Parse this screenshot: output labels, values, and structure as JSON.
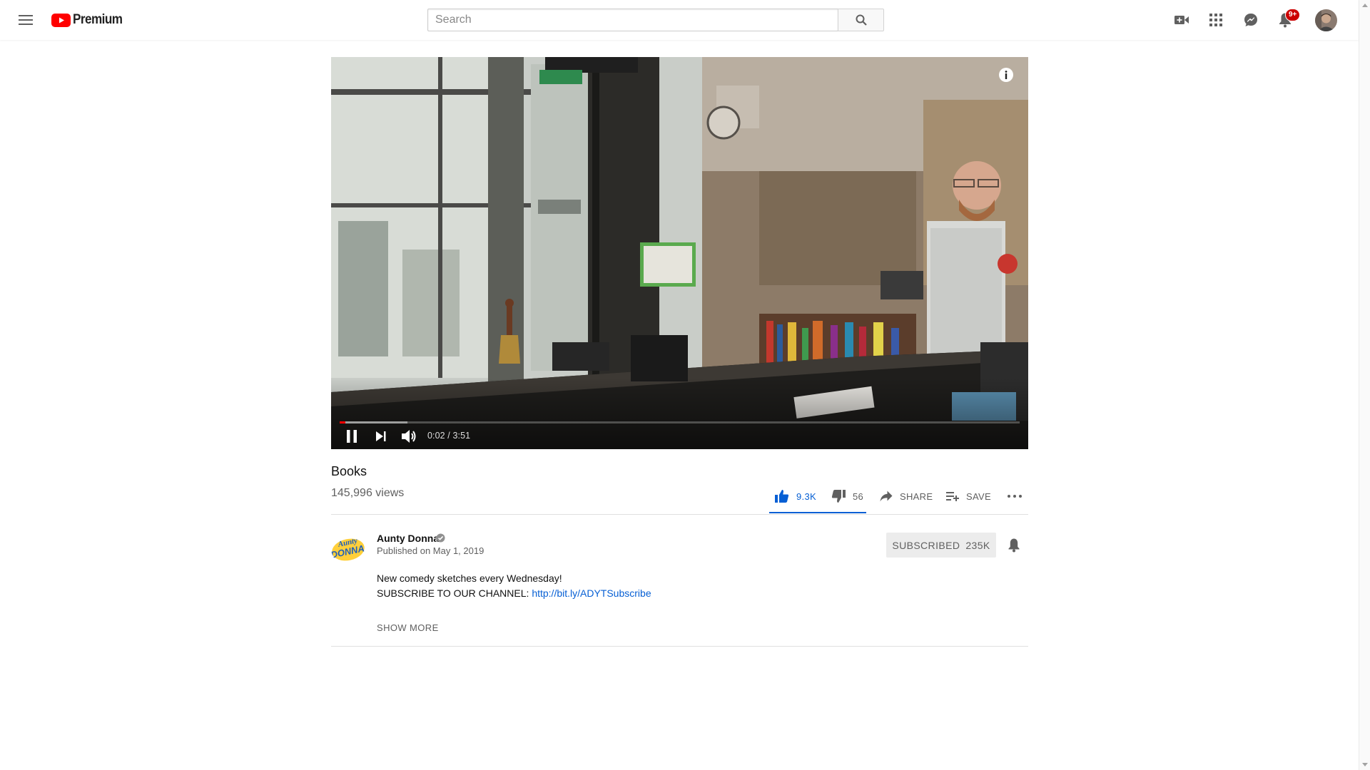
{
  "masthead": {
    "menu_icon": "hamburger-menu-icon",
    "logo_text": "Premium",
    "logo_color": "#ff0000",
    "search": {
      "placeholder": "Search",
      "value": ""
    },
    "icons": [
      "video-camera-icon",
      "apps-grid-icon",
      "messages-icon",
      "bell-icon"
    ],
    "notification_badge": "9+"
  },
  "player": {
    "time_current": "0:02",
    "time_separator": " / ",
    "time_total": "3:51",
    "progress_fraction": 0.0087,
    "buffered_fraction": 0.1
  },
  "video": {
    "title": "Books",
    "views": "145,996 views"
  },
  "actions": {
    "like_count": "9.3K",
    "dislike_count": "56",
    "share_label": "SHARE",
    "save_label": "SAVE",
    "like_color": "#065fd4"
  },
  "channel": {
    "name": "Aunty Donna",
    "published": "Published on May 1, 2019",
    "subscribe_label": "SUBSCRIBED",
    "subscriber_count": "235K",
    "logo_text_1": "Aunty",
    "logo_text_2": "DONNA"
  },
  "description": {
    "line1": "New comedy sketches every Wednesday!",
    "line2_prefix": "SUBSCRIBE TO OUR CHANNEL: ",
    "line2_link": "http://bit.ly/ADYTSubscribe",
    "show_more": "SHOW MORE"
  }
}
